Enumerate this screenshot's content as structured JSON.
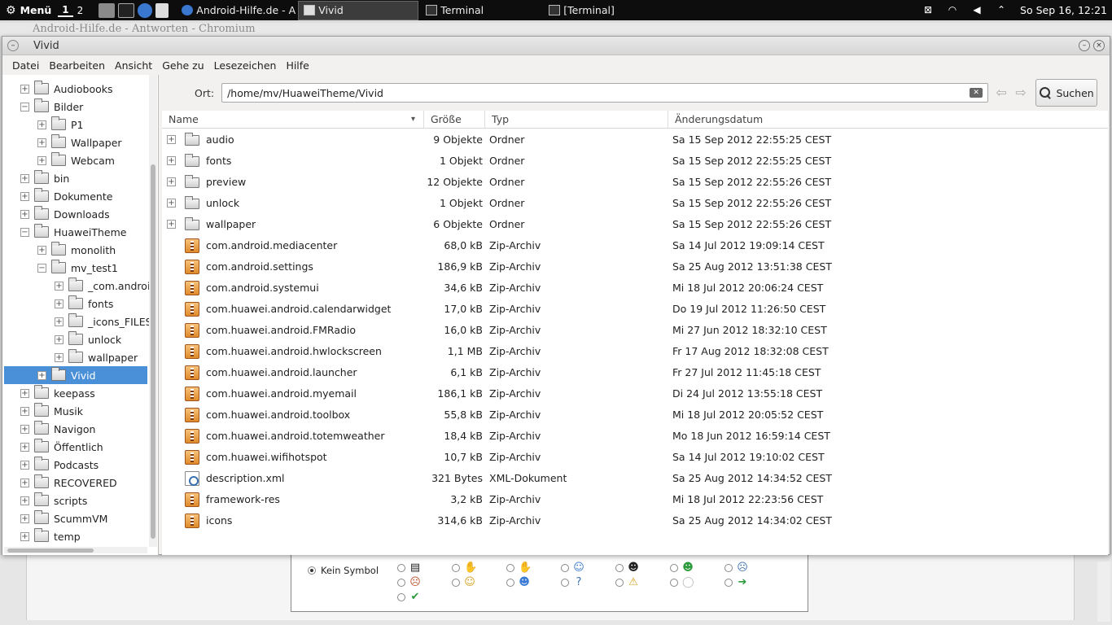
{
  "panel": {
    "menu_label": "Menü",
    "workspaces": [
      "1",
      "2"
    ],
    "tasks": [
      {
        "label": "Android-Hilfe.de - An…",
        "active": false
      },
      {
        "label": "Vivid",
        "active": true
      },
      {
        "label": "Terminal",
        "active": false
      },
      {
        "label": "[Terminal]",
        "active": false
      }
    ],
    "clock": "So Sep 16, 12:21"
  },
  "background_window": {
    "title": "Android-Hilfe.de - Antworten - Chromium",
    "radio_label": "Kein Symbol"
  },
  "window": {
    "title": "Vivid",
    "menu": [
      "Datei",
      "Bearbeiten",
      "Ansicht",
      "Gehe zu",
      "Lesezeichen",
      "Hilfe"
    ]
  },
  "location": {
    "label": "Ort:",
    "path": "/home/mv/HuaweiTheme/Vivid",
    "search_label": "Suchen"
  },
  "columns": {
    "name": "Name",
    "size": "Größe",
    "type": "Typ",
    "date": "Änderungsdatum"
  },
  "tree": [
    {
      "label": "Audiobooks",
      "level": 0,
      "expander": "+"
    },
    {
      "label": "Bilder",
      "level": 0,
      "expander": "−"
    },
    {
      "label": "P1",
      "level": 1,
      "expander": "+"
    },
    {
      "label": "Wallpaper",
      "level": 1,
      "expander": "+"
    },
    {
      "label": "Webcam",
      "level": 1,
      "expander": "+"
    },
    {
      "label": "bin",
      "level": 0,
      "expander": "+"
    },
    {
      "label": "Dokumente",
      "level": 0,
      "expander": "+"
    },
    {
      "label": "Downloads",
      "level": 0,
      "expander": "+"
    },
    {
      "label": "HuaweiTheme",
      "level": 0,
      "expander": "−"
    },
    {
      "label": "monolith",
      "level": 1,
      "expander": "+"
    },
    {
      "label": "mv_test1",
      "level": 1,
      "expander": "−"
    },
    {
      "label": "_com.androi",
      "level": 2,
      "expander": "+"
    },
    {
      "label": "fonts",
      "level": 2,
      "expander": "+"
    },
    {
      "label": "_icons_FILES",
      "level": 2,
      "expander": "+"
    },
    {
      "label": "unlock",
      "level": 2,
      "expander": "+"
    },
    {
      "label": "wallpaper",
      "level": 2,
      "expander": "+"
    },
    {
      "label": "Vivid",
      "level": 1,
      "expander": "+",
      "selected": true
    },
    {
      "label": "keepass",
      "level": 0,
      "expander": "+"
    },
    {
      "label": "Musik",
      "level": 0,
      "expander": "+"
    },
    {
      "label": "Navigon",
      "level": 0,
      "expander": "+"
    },
    {
      "label": "Öffentlich",
      "level": 0,
      "expander": "+"
    },
    {
      "label": "Podcasts",
      "level": 0,
      "expander": "+"
    },
    {
      "label": "RECOVERED",
      "level": 0,
      "expander": "+"
    },
    {
      "label": "scripts",
      "level": 0,
      "expander": "+"
    },
    {
      "label": "ScummVM",
      "level": 0,
      "expander": "+"
    },
    {
      "label": "temp",
      "level": 0,
      "expander": "+"
    }
  ],
  "files": [
    {
      "name": "audio",
      "size": "9 Objekte",
      "type": "Ordner",
      "date": "Sa 15 Sep 2012 22:55:25 CEST",
      "icon": "folder"
    },
    {
      "name": "fonts",
      "size": "1 Objekt",
      "type": "Ordner",
      "date": "Sa 15 Sep 2012 22:55:25 CEST",
      "icon": "folder"
    },
    {
      "name": "preview",
      "size": "12 Objekte",
      "type": "Ordner",
      "date": "Sa 15 Sep 2012 22:55:26 CEST",
      "icon": "folder"
    },
    {
      "name": "unlock",
      "size": "1 Objekt",
      "type": "Ordner",
      "date": "Sa 15 Sep 2012 22:55:26 CEST",
      "icon": "folder"
    },
    {
      "name": "wallpaper",
      "size": "6 Objekte",
      "type": "Ordner",
      "date": "Sa 15 Sep 2012 22:55:26 CEST",
      "icon": "folder"
    },
    {
      "name": "com.android.mediacenter",
      "size": "68,0 kB",
      "type": "Zip-Archiv",
      "date": "Sa 14 Jul 2012 19:09:14 CEST",
      "icon": "zip"
    },
    {
      "name": "com.android.settings",
      "size": "186,9 kB",
      "type": "Zip-Archiv",
      "date": "Sa 25 Aug 2012 13:51:38 CEST",
      "icon": "zip"
    },
    {
      "name": "com.android.systemui",
      "size": "34,6 kB",
      "type": "Zip-Archiv",
      "date": "Mi 18 Jul 2012 20:06:24 CEST",
      "icon": "zip"
    },
    {
      "name": "com.huawei.android.calendarwidget",
      "size": "17,0 kB",
      "type": "Zip-Archiv",
      "date": "Do 19 Jul 2012 11:26:50 CEST",
      "icon": "zip"
    },
    {
      "name": "com.huawei.android.FMRadio",
      "size": "16,0 kB",
      "type": "Zip-Archiv",
      "date": "Mi 27 Jun 2012 18:32:10 CEST",
      "icon": "zip"
    },
    {
      "name": "com.huawei.android.hwlockscreen",
      "size": "1,1 MB",
      "type": "Zip-Archiv",
      "date": "Fr 17 Aug 2012 18:32:08 CEST",
      "icon": "zip"
    },
    {
      "name": "com.huawei.android.launcher",
      "size": "6,1 kB",
      "type": "Zip-Archiv",
      "date": "Fr 27 Jul 2012 11:45:18 CEST",
      "icon": "zip"
    },
    {
      "name": "com.huawei.android.myemail",
      "size": "186,1 kB",
      "type": "Zip-Archiv",
      "date": "Di 24 Jul 2012 13:55:18 CEST",
      "icon": "zip"
    },
    {
      "name": "com.huawei.android.toolbox",
      "size": "55,8 kB",
      "type": "Zip-Archiv",
      "date": "Mi 18 Jul 2012 20:05:52 CEST",
      "icon": "zip"
    },
    {
      "name": "com.huawei.android.totemweather",
      "size": "18,4 kB",
      "type": "Zip-Archiv",
      "date": "Mo 18 Jun 2012 16:59:14 CEST",
      "icon": "zip"
    },
    {
      "name": "com.huawei.wifihotspot",
      "size": "10,7 kB",
      "type": "Zip-Archiv",
      "date": "Sa 14 Jul 2012 19:10:02 CEST",
      "icon": "zip"
    },
    {
      "name": "description.xml",
      "size": "321 Bytes",
      "type": "XML-Dokument",
      "date": "Sa 25 Aug 2012 14:34:52 CEST",
      "icon": "xml"
    },
    {
      "name": "framework-res",
      "size": "3,2 kB",
      "type": "Zip-Archiv",
      "date": "Mi 18 Jul 2012 22:23:56 CEST",
      "icon": "zip"
    },
    {
      "name": "icons",
      "size": "314,6 kB",
      "type": "Zip-Archiv",
      "date": "Sa 25 Aug 2012 14:34:02 CEST",
      "icon": "zip"
    }
  ],
  "emoticons": [
    "document-icon",
    "thumbs-up-icon",
    "thumbs-down-icon",
    "smile-blue-icon",
    "grin-icon",
    "big-grin-green-icon",
    "sad-blue-icon",
    "angry-icon",
    "smile-yellow-icon",
    "cool-icon",
    "question-icon",
    "warning-icon",
    "lightbulb-icon",
    "arrow-right-icon",
    "check-icon"
  ]
}
